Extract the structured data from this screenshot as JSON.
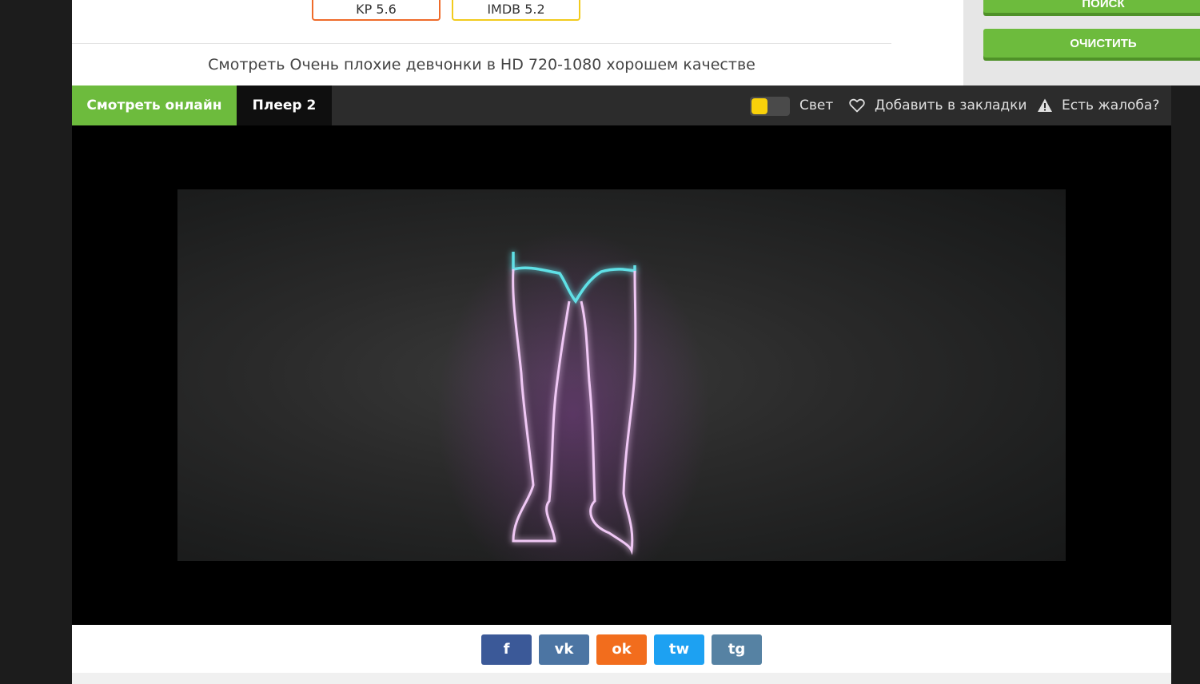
{
  "sidebar": {
    "search_label": "ПОИСК",
    "clear_label": "ОЧИСТИТЬ"
  },
  "ratings": {
    "kp": "KP 5.6",
    "imdb": "IMDB 5.2"
  },
  "watch_title": "Смотреть Очень плохие девчонки в HD 720-1080 хорошем качестве",
  "tabs": {
    "watch_online": "Смотреть онлайн",
    "player2": "Плеер 2"
  },
  "toolbar": {
    "light_label": "Свет",
    "bookmark_label": "Добавить в закладки",
    "complaint_label": "Есть жалоба?"
  },
  "share": {
    "facebook": "f",
    "vk": "vk",
    "ok": "ok",
    "twitter": "tw",
    "telegram": "tg"
  },
  "colors": {
    "accent_green": "#6dbb3d",
    "kp_orange": "#ef6b2a",
    "imdb_yellow": "#f2cb1d",
    "toggle_yellow": "#f9d10a"
  }
}
